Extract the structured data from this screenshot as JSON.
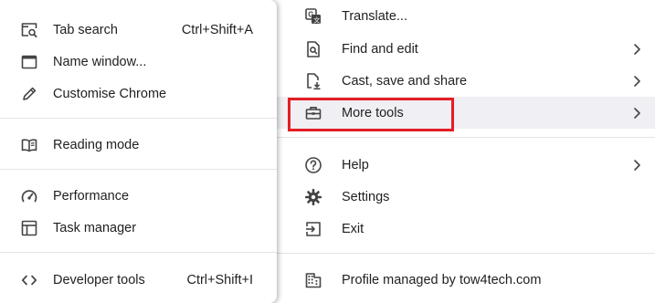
{
  "submenu": {
    "items": [
      {
        "label": "Tab search",
        "shortcut": "Ctrl+Shift+A",
        "icon": "tab-search-icon"
      },
      {
        "label": "Name window...",
        "shortcut": "",
        "icon": "window-icon"
      },
      {
        "label": "Customise Chrome",
        "shortcut": "",
        "icon": "pencil-icon"
      },
      {
        "label": "Reading mode",
        "shortcut": "",
        "icon": "book-icon"
      },
      {
        "label": "Performance",
        "shortcut": "",
        "icon": "speedometer-icon"
      },
      {
        "label": "Task manager",
        "shortcut": "",
        "icon": "task-manager-icon"
      },
      {
        "label": "Developer tools",
        "shortcut": "Ctrl+Shift+I",
        "icon": "code-icon"
      }
    ]
  },
  "mainmenu": {
    "items": [
      {
        "label": "Translate...",
        "icon": "translate-icon"
      },
      {
        "label": "Find and edit",
        "icon": "find-icon"
      },
      {
        "label": "Cast, save and share",
        "icon": "cast-save-share-icon"
      },
      {
        "label": "More tools",
        "icon": "toolbox-icon"
      },
      {
        "label": "Help",
        "icon": "help-icon"
      },
      {
        "label": "Settings",
        "icon": "gear-icon"
      },
      {
        "label": "Exit",
        "icon": "exit-icon"
      },
      {
        "label": "Profile managed by tow4tech.com",
        "icon": "building-icon"
      }
    ]
  },
  "colors": {
    "highlight_box": "#e31e24",
    "hover_background": "#f0eff3",
    "separator": "#e3e3e3",
    "text": "#1f1f1f"
  }
}
